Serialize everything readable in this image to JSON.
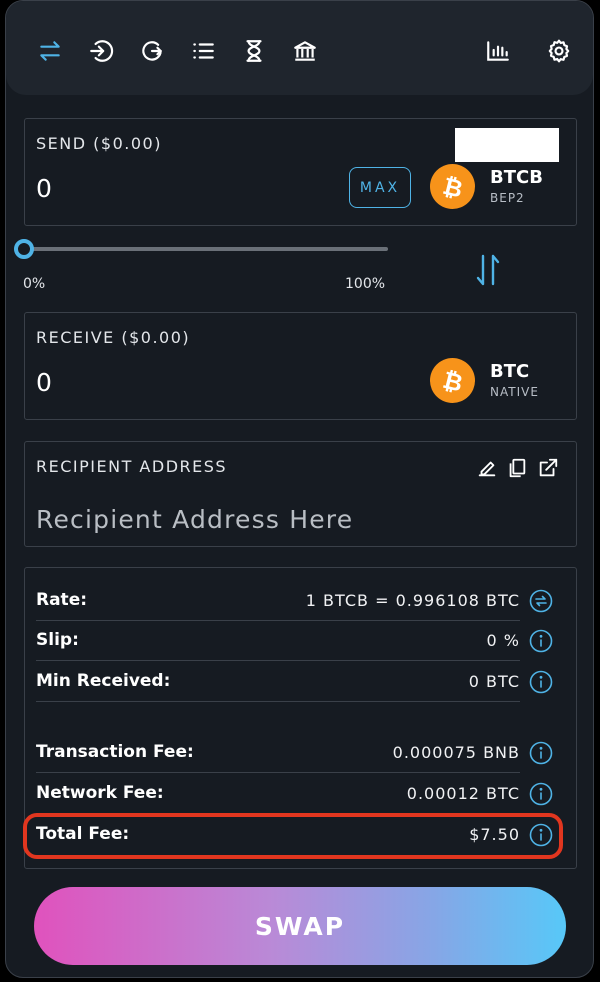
{
  "nav": {
    "icons": [
      "swap-icon",
      "sign-in-icon",
      "redo-icon",
      "list-icon",
      "hourglass-icon",
      "bank-icon",
      "chart-icon",
      "gear-icon"
    ],
    "active": "swap-icon",
    "accent": "#4fb3e6"
  },
  "send": {
    "label": "SEND ($0.00)",
    "amount": "0",
    "max_label": "MAX",
    "asset": {
      "symbol": "BTCB",
      "chain": "BEP2",
      "icon": "bitcoin-icon"
    }
  },
  "slider": {
    "value_percent": 0,
    "min_label": "0%",
    "max_label": "100%"
  },
  "receive": {
    "label": "RECEIVE ($0.00)",
    "amount": "0",
    "asset": {
      "symbol": "BTC",
      "chain": "NATIVE",
      "icon": "bitcoin-icon"
    }
  },
  "recipient": {
    "label": "RECIPIENT ADDRESS",
    "placeholder": "Recipient Address Here",
    "value": "",
    "tools": [
      "edit-icon",
      "copy-icon",
      "external-link-icon"
    ]
  },
  "details": {
    "rate": {
      "label": "Rate:",
      "value": "1 BTCB = 0.996108 BTC"
    },
    "slip": {
      "label": "Slip:",
      "value": "0 %"
    },
    "min_received": {
      "label": "Min Received:",
      "value": "0 BTC"
    },
    "transaction_fee": {
      "label": "Transaction Fee:",
      "value": "0.000075 BNB"
    },
    "network_fee": {
      "label": "Network Fee:",
      "value": "0.00012 BTC"
    },
    "total_fee": {
      "label": "Total Fee:",
      "value": "$7.50"
    }
  },
  "highlight_color": "#e1361f",
  "swap_button": {
    "label": "SWAP"
  }
}
